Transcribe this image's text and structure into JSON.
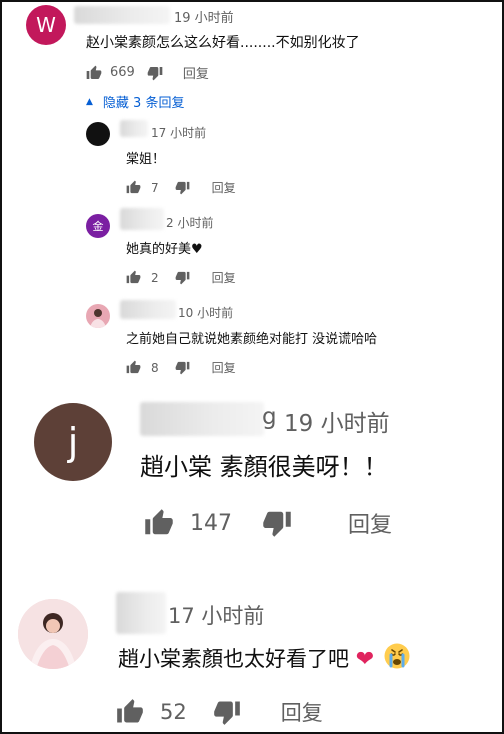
{
  "comments": [
    {
      "avatar_letter": "W",
      "avatar_color": "#c2185b",
      "time": "19 小时前",
      "text": "赵小棠素颜怎么这么好看........不如别化妆了",
      "likes": "669",
      "reply_label": "回复"
    },
    {
      "avatar_color": "#111111",
      "time": "17 小时前",
      "text": "棠姐！",
      "likes": "7",
      "reply_label": "回复"
    },
    {
      "avatar_letter": "金",
      "avatar_color": "#7b1fa2",
      "time": "2 小时前",
      "text": "她真的好美",
      "likes": "2",
      "reply_label": "回复"
    },
    {
      "avatar_color": "#e8a7b3",
      "time": "10 小时前",
      "text": "之前她自己就说她素颜绝对能打 没说谎哈哈",
      "likes": "8",
      "reply_label": "回复"
    },
    {
      "avatar_letter": "j",
      "avatar_color": "#5d4037",
      "name_fragment": "g",
      "time": "19 小时前",
      "text": "趙小棠 素顏很美呀！！",
      "likes": "147",
      "reply_label": "回复"
    },
    {
      "avatar_color": "#f3d6d8",
      "time": "17 小时前",
      "text": "趙小棠素顏也太好看了吧",
      "likes": "52",
      "reply_label": "回复"
    }
  ],
  "replies_toggle": {
    "label": "隐藏 3 条回复",
    "color": "#065fd4"
  }
}
